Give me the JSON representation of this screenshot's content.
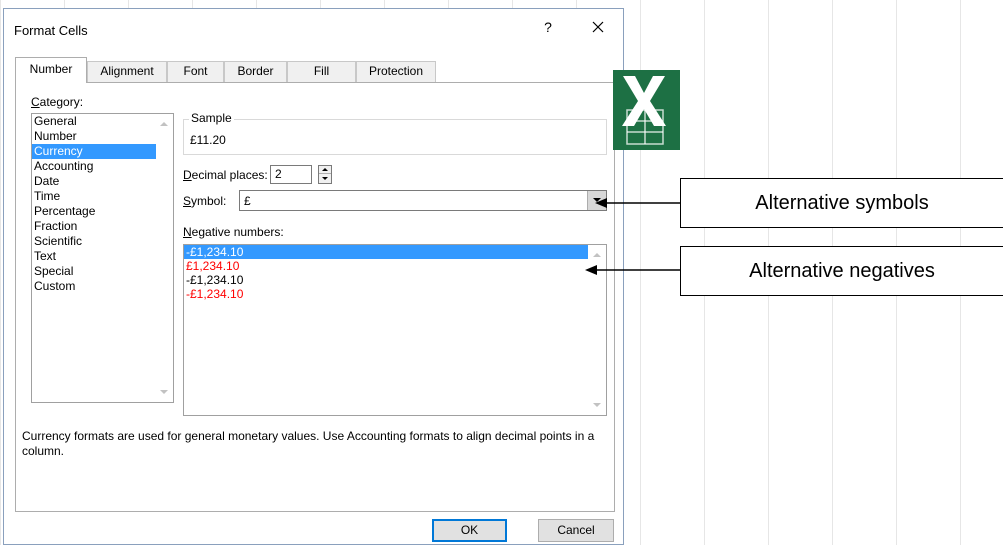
{
  "dialog": {
    "title": "Format Cells",
    "help_label": "?",
    "tabs": [
      {
        "label": "Number",
        "active": true
      },
      {
        "label": "Alignment",
        "active": false
      },
      {
        "label": "Font",
        "active": false
      },
      {
        "label": "Border",
        "active": false
      },
      {
        "label": "Fill",
        "active": false
      },
      {
        "label": "Protection",
        "active": false
      }
    ]
  },
  "number_tab": {
    "category_label_mnemonic": "C",
    "category_label_rest": "ategory:",
    "categories": [
      "General",
      "Number",
      "Currency",
      "Accounting",
      "Date",
      "Time",
      "Percentage",
      "Fraction",
      "Scientific",
      "Text",
      "Special",
      "Custom"
    ],
    "selected_category": "Currency",
    "sample_legend": "Sample",
    "sample_value": "£11.20",
    "decimal_label_mnemonic": "D",
    "decimal_label_rest": "ecimal places:",
    "decimal_value": "2",
    "symbol_label_mnemonic": "S",
    "symbol_label_rest": "ymbol:",
    "symbol_value": "£",
    "negative_label_mnemonic": "N",
    "negative_label_rest": "egative numbers:",
    "negative_numbers": [
      {
        "text": "-£1,234.10",
        "color": "#ffffff",
        "selected": true
      },
      {
        "text": "£1,234.10",
        "color": "#ff0000",
        "selected": false
      },
      {
        "text": "-£1,234.10",
        "color": "#000000",
        "selected": false
      },
      {
        "text": "-£1,234.10",
        "color": "#ff0000",
        "selected": false
      }
    ],
    "description": "Currency formats are used for general monetary values.  Use Accounting formats to align decimal points in a column."
  },
  "buttons": {
    "ok": "OK",
    "cancel": "Cancel"
  },
  "callouts": {
    "symbols": "Alternative symbols",
    "negatives": "Alternative negatives"
  },
  "icons": {
    "close": "close-icon",
    "excel": "excel-logo-icon"
  },
  "colors": {
    "selection": "#3399ff",
    "negative_red": "#ff0000",
    "excel_green": "#1d7044"
  }
}
